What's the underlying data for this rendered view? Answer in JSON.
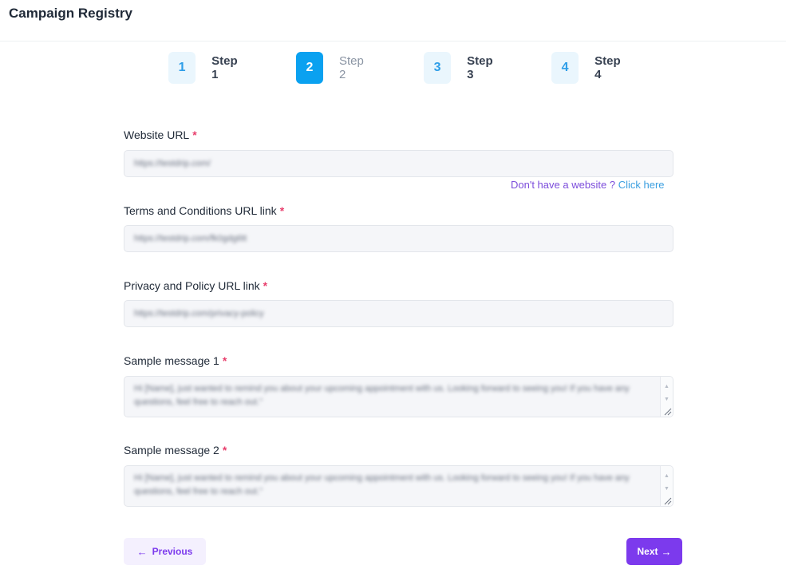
{
  "app": {
    "title": "Campaign Registry"
  },
  "steps": [
    {
      "number": "1",
      "label": "Step 1"
    },
    {
      "number": "2",
      "label": "Step 2"
    },
    {
      "number": "3",
      "label": "Step 3"
    },
    {
      "number": "4",
      "label": "Step 4"
    }
  ],
  "active_step": 2,
  "form": {
    "required_marker": "*",
    "website_url": {
      "label": "Website URL",
      "value": "https://testdrip.com/"
    },
    "website_help": {
      "text": "Don't have a website ? ",
      "link": "Click here"
    },
    "terms_url": {
      "label": "Terms and Conditions URL link",
      "value": "https://testdrip.com/fk0gdg6tt"
    },
    "privacy_url": {
      "label": "Privacy and Policy URL link",
      "value": "https://testdrip.com/privacy-policy"
    },
    "sample_message_1": {
      "label": "Sample message 1",
      "value": "Hi [Name], just wanted to remind you about your upcoming appointment with us. Looking forward to seeing you! If you have any questions, feel free to reach out.\""
    },
    "sample_message_2": {
      "label": "Sample message 2",
      "value": "Hi [Name], just wanted to remind you about your upcoming appointment with us. Looking forward to seeing you! If you have any questions, feel free to reach out.\""
    }
  },
  "buttons": {
    "previous": "Previous",
    "next": "Next"
  },
  "icons": {
    "previous": "arrow-left-icon",
    "next": "arrow-right-icon"
  },
  "colors": {
    "accent": "#7c3aed",
    "step_active": "#0aa1f0",
    "required": "#e83e6c",
    "link": "#3b9fe0"
  }
}
